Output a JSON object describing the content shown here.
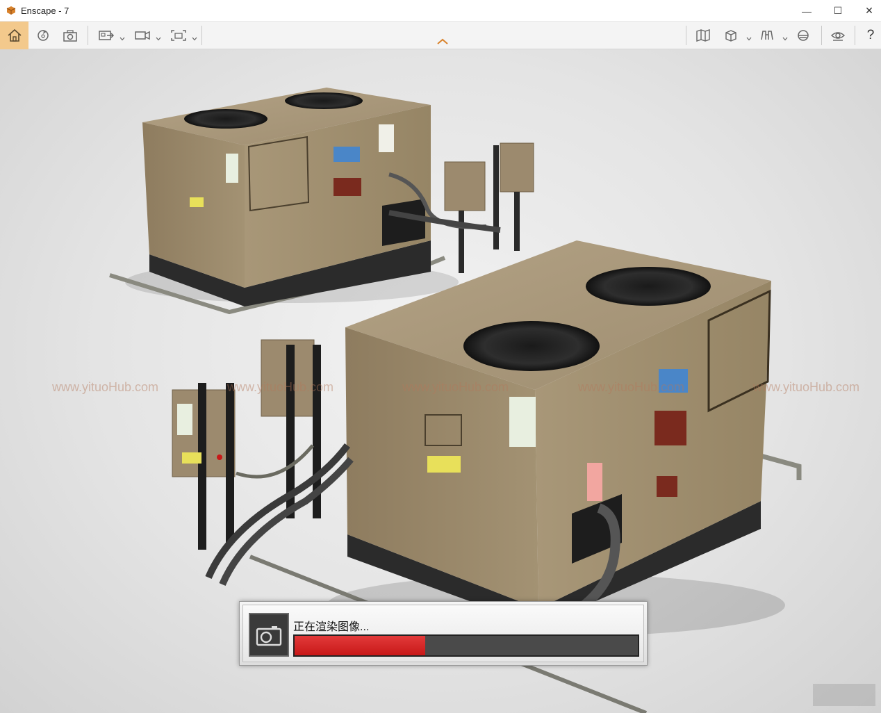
{
  "window": {
    "title": "Enscape - 7",
    "icon": "enscape-logo-icon",
    "minimize_glyph": "—",
    "maximize_glyph": "☐",
    "close_glyph": "✕"
  },
  "toolbar": {
    "left_items": [
      {
        "name": "home-icon",
        "active": true
      },
      {
        "name": "refresh-view-icon"
      },
      {
        "name": "screenshot-capture-icon"
      },
      {
        "name": "export-image-icon",
        "dropdown": true
      },
      {
        "name": "video-editor-icon",
        "dropdown": true
      },
      {
        "name": "batch-render-icon",
        "dropdown": true
      }
    ],
    "right_items": [
      {
        "name": "map-icon"
      },
      {
        "name": "cube-view-icon",
        "dropdown": true
      },
      {
        "name": "binoculars-icon",
        "dropdown": true
      },
      {
        "name": "vr-headset-icon"
      },
      {
        "name": "eye-visibility-icon"
      }
    ],
    "help_label": "?"
  },
  "watermarks": [
    "www.yituoHub.com",
    "www.yituoHub.com",
    "www.yituoHub.com",
    "www.yituoHub.com",
    "www.yituoHub.com"
  ],
  "render_dialog": {
    "label": "正在渲染图像...",
    "progress": 0.38,
    "icon": "camera-icon"
  },
  "colors": {
    "accent_home": "#f3c98c",
    "progress_red": "#d42424",
    "unit_body": "#9c8a6e"
  }
}
